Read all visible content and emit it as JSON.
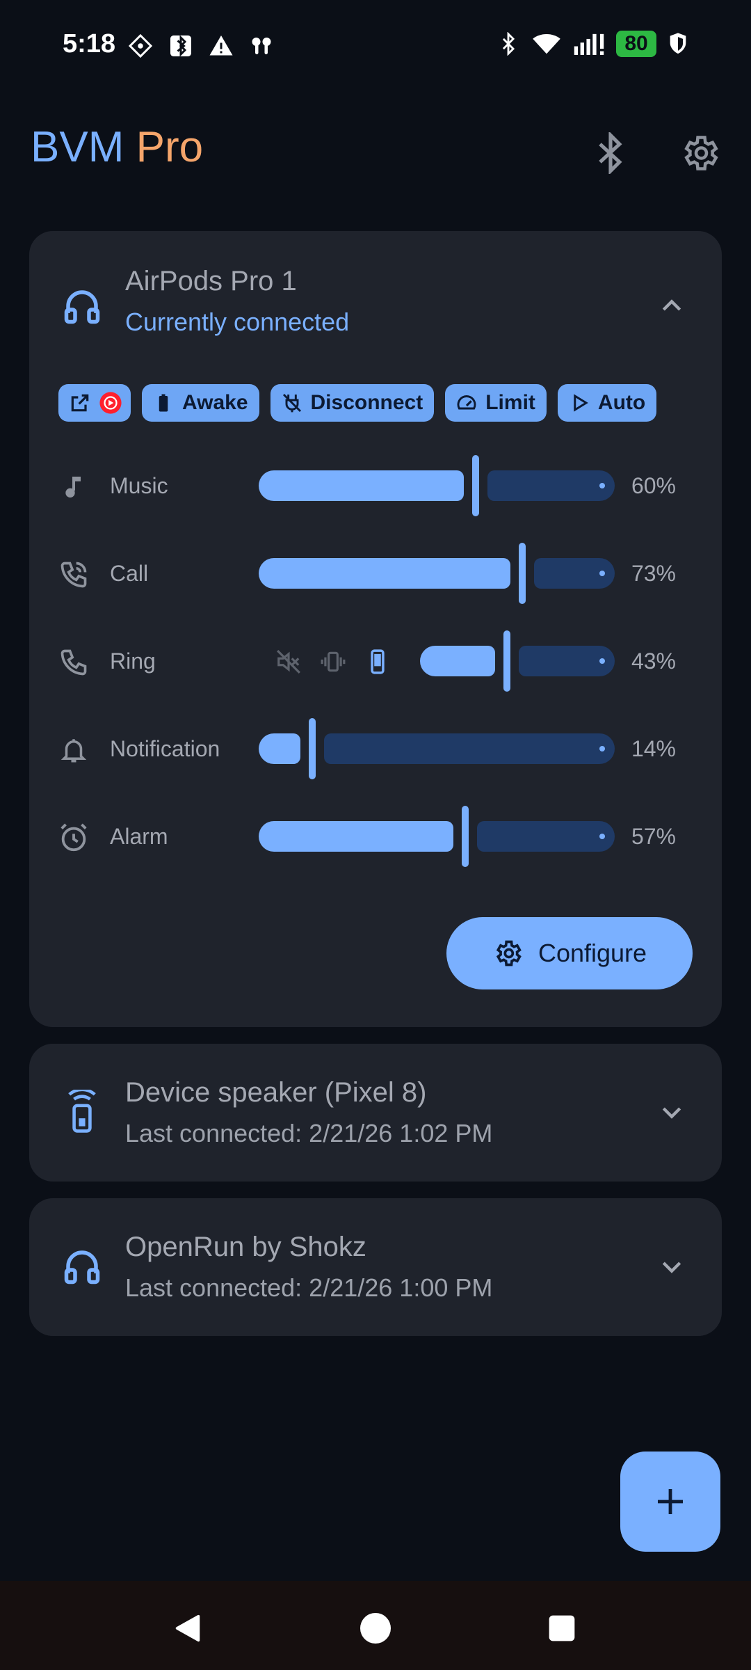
{
  "status_bar": {
    "time": "5:18",
    "battery": "80",
    "left_icons": [
      "app-grid-icon",
      "nfc-bluetooth-icon",
      "warning-icon",
      "earbuds-icon"
    ],
    "right_icons": [
      "bluetooth-icon",
      "wifi-icon",
      "signal-icon",
      "battery-icon",
      "vpn-shield-icon"
    ]
  },
  "header": {
    "title_part1": "BVM",
    "title_part2": "Pro",
    "title_color1": "#7ab0ff",
    "title_color2": "#f5a56b"
  },
  "devices": [
    {
      "name": "AirPods Pro 1",
      "status": "Currently connected",
      "expanded": true,
      "chips": [
        {
          "label": "",
          "icon": "open-external-icon"
        },
        {
          "label": "Awake",
          "icon": "battery-icon"
        },
        {
          "label": "Disconnect",
          "icon": "power-off-icon"
        },
        {
          "label": "Limit",
          "icon": "speedometer-icon"
        },
        {
          "label": "Auto",
          "icon": "play-icon"
        }
      ],
      "volumes": [
        {
          "label": "Music",
          "percent_text": "60%",
          "value": 0.6,
          "icon": "music-note-icon"
        },
        {
          "label": "Call",
          "percent_text": "73%",
          "value": 0.73,
          "icon": "phone-call-icon"
        },
        {
          "label": "Ring",
          "percent_text": "43%",
          "value": 0.43,
          "icon": "phone-icon",
          "modes": [
            "mute-icon",
            "vibrate-icon",
            "sound-device-icon"
          ],
          "active_mode": 2
        },
        {
          "label": "Notification",
          "percent_text": "14%",
          "value": 0.14,
          "icon": "bell-icon"
        },
        {
          "label": "Alarm",
          "percent_text": "57%",
          "value": 0.57,
          "icon": "alarm-icon"
        }
      ],
      "configure_label": "Configure"
    },
    {
      "name": "Device speaker (Pixel 8)",
      "status": "Last connected: 2/21/26 1:02 PM",
      "expanded": false
    },
    {
      "name": "OpenRun by Shokz",
      "status": "Last connected: 2/21/26 1:00 PM",
      "expanded": false
    }
  ],
  "colors": {
    "accent": "#7ab0ff",
    "card": "#1f232c",
    "background": "#0b0f17",
    "track_rest": "#1f3a66"
  }
}
